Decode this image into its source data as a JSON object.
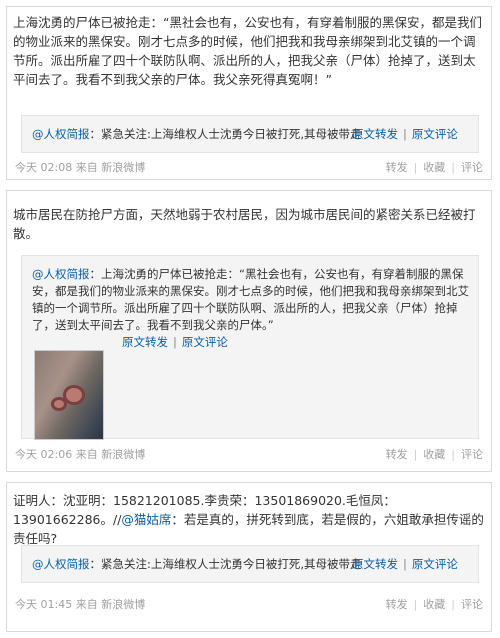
{
  "posts": [
    {
      "body": "上海沈勇的尸体已被抢走：“黑社会也有，公安也有，有穿着制服的黑保安，都是我们的物业派来的黑保安。刚才七点多的时候，他们把我和我母亲绑架到北艾镇的一个调节所。派出所雇了四十个联防队啊、派出所的人，把我父亲（尸体）抢掉了，送到太平间去了。我看不到我父亲的尸体。我父亲死得真冤啊！”",
      "quote": {
        "author": "@人权简报",
        "text": "：紧急关注:上海维权人士沈勇今日被打死,其母被带走",
        "repost_label": "原文转发",
        "comment_label": "原文评论"
      },
      "meta": {
        "time": "今天 02:08",
        "source_prefix": "来自",
        "source": "新浪微博",
        "repost": "转发",
        "favorite": "收藏",
        "comment": "评论"
      }
    },
    {
      "body": "城市居民在防抢尸方面，天然地弱于农村居民，因为城市居民间的紧密关系已经被打散。",
      "quote": {
        "author": "@人权简报",
        "text": "：上海沈勇的尸体已被抢走：“黑社会也有，公安也有，有穿着制服的黑保安，都是我们的物业派来的黑保安。刚才七点多的时候，他们把我和我母亲绑架到北艾镇的一个调节所。派出所雇了四十个联防队啊、派出所的人，把我父亲（尸体）抢掉了，送到太平间去了。我看不到我父亲的尸体。”",
        "repost_label": "原文转发",
        "comment_label": "原文评论"
      },
      "meta": {
        "time": "今天 02:06",
        "source_prefix": "来自",
        "source": "新浪微博",
        "repost": "转发",
        "favorite": "收藏",
        "comment": "评论"
      }
    },
    {
      "body_prefix": "证明人：沈亚明：15821201085.李贵荣：13501869020.毛恒凤：13901662286。//",
      "body_mention": "@猫姑席",
      "body_suffix": "：若是真的，拼死转到底，若是假的，六姐敢承担传谣的责任吗?",
      "quote": {
        "author": "@人权简报",
        "text": "：紧急关注:上海维权人士沈勇今日被打死,其母被带走",
        "repost_label": "原文转发",
        "comment_label": "原文评论"
      },
      "meta": {
        "time": "今天 01:45",
        "source_prefix": "来自",
        "source": "新浪微博",
        "repost": "转发",
        "favorite": "收藏",
        "comment": "评论"
      }
    }
  ]
}
